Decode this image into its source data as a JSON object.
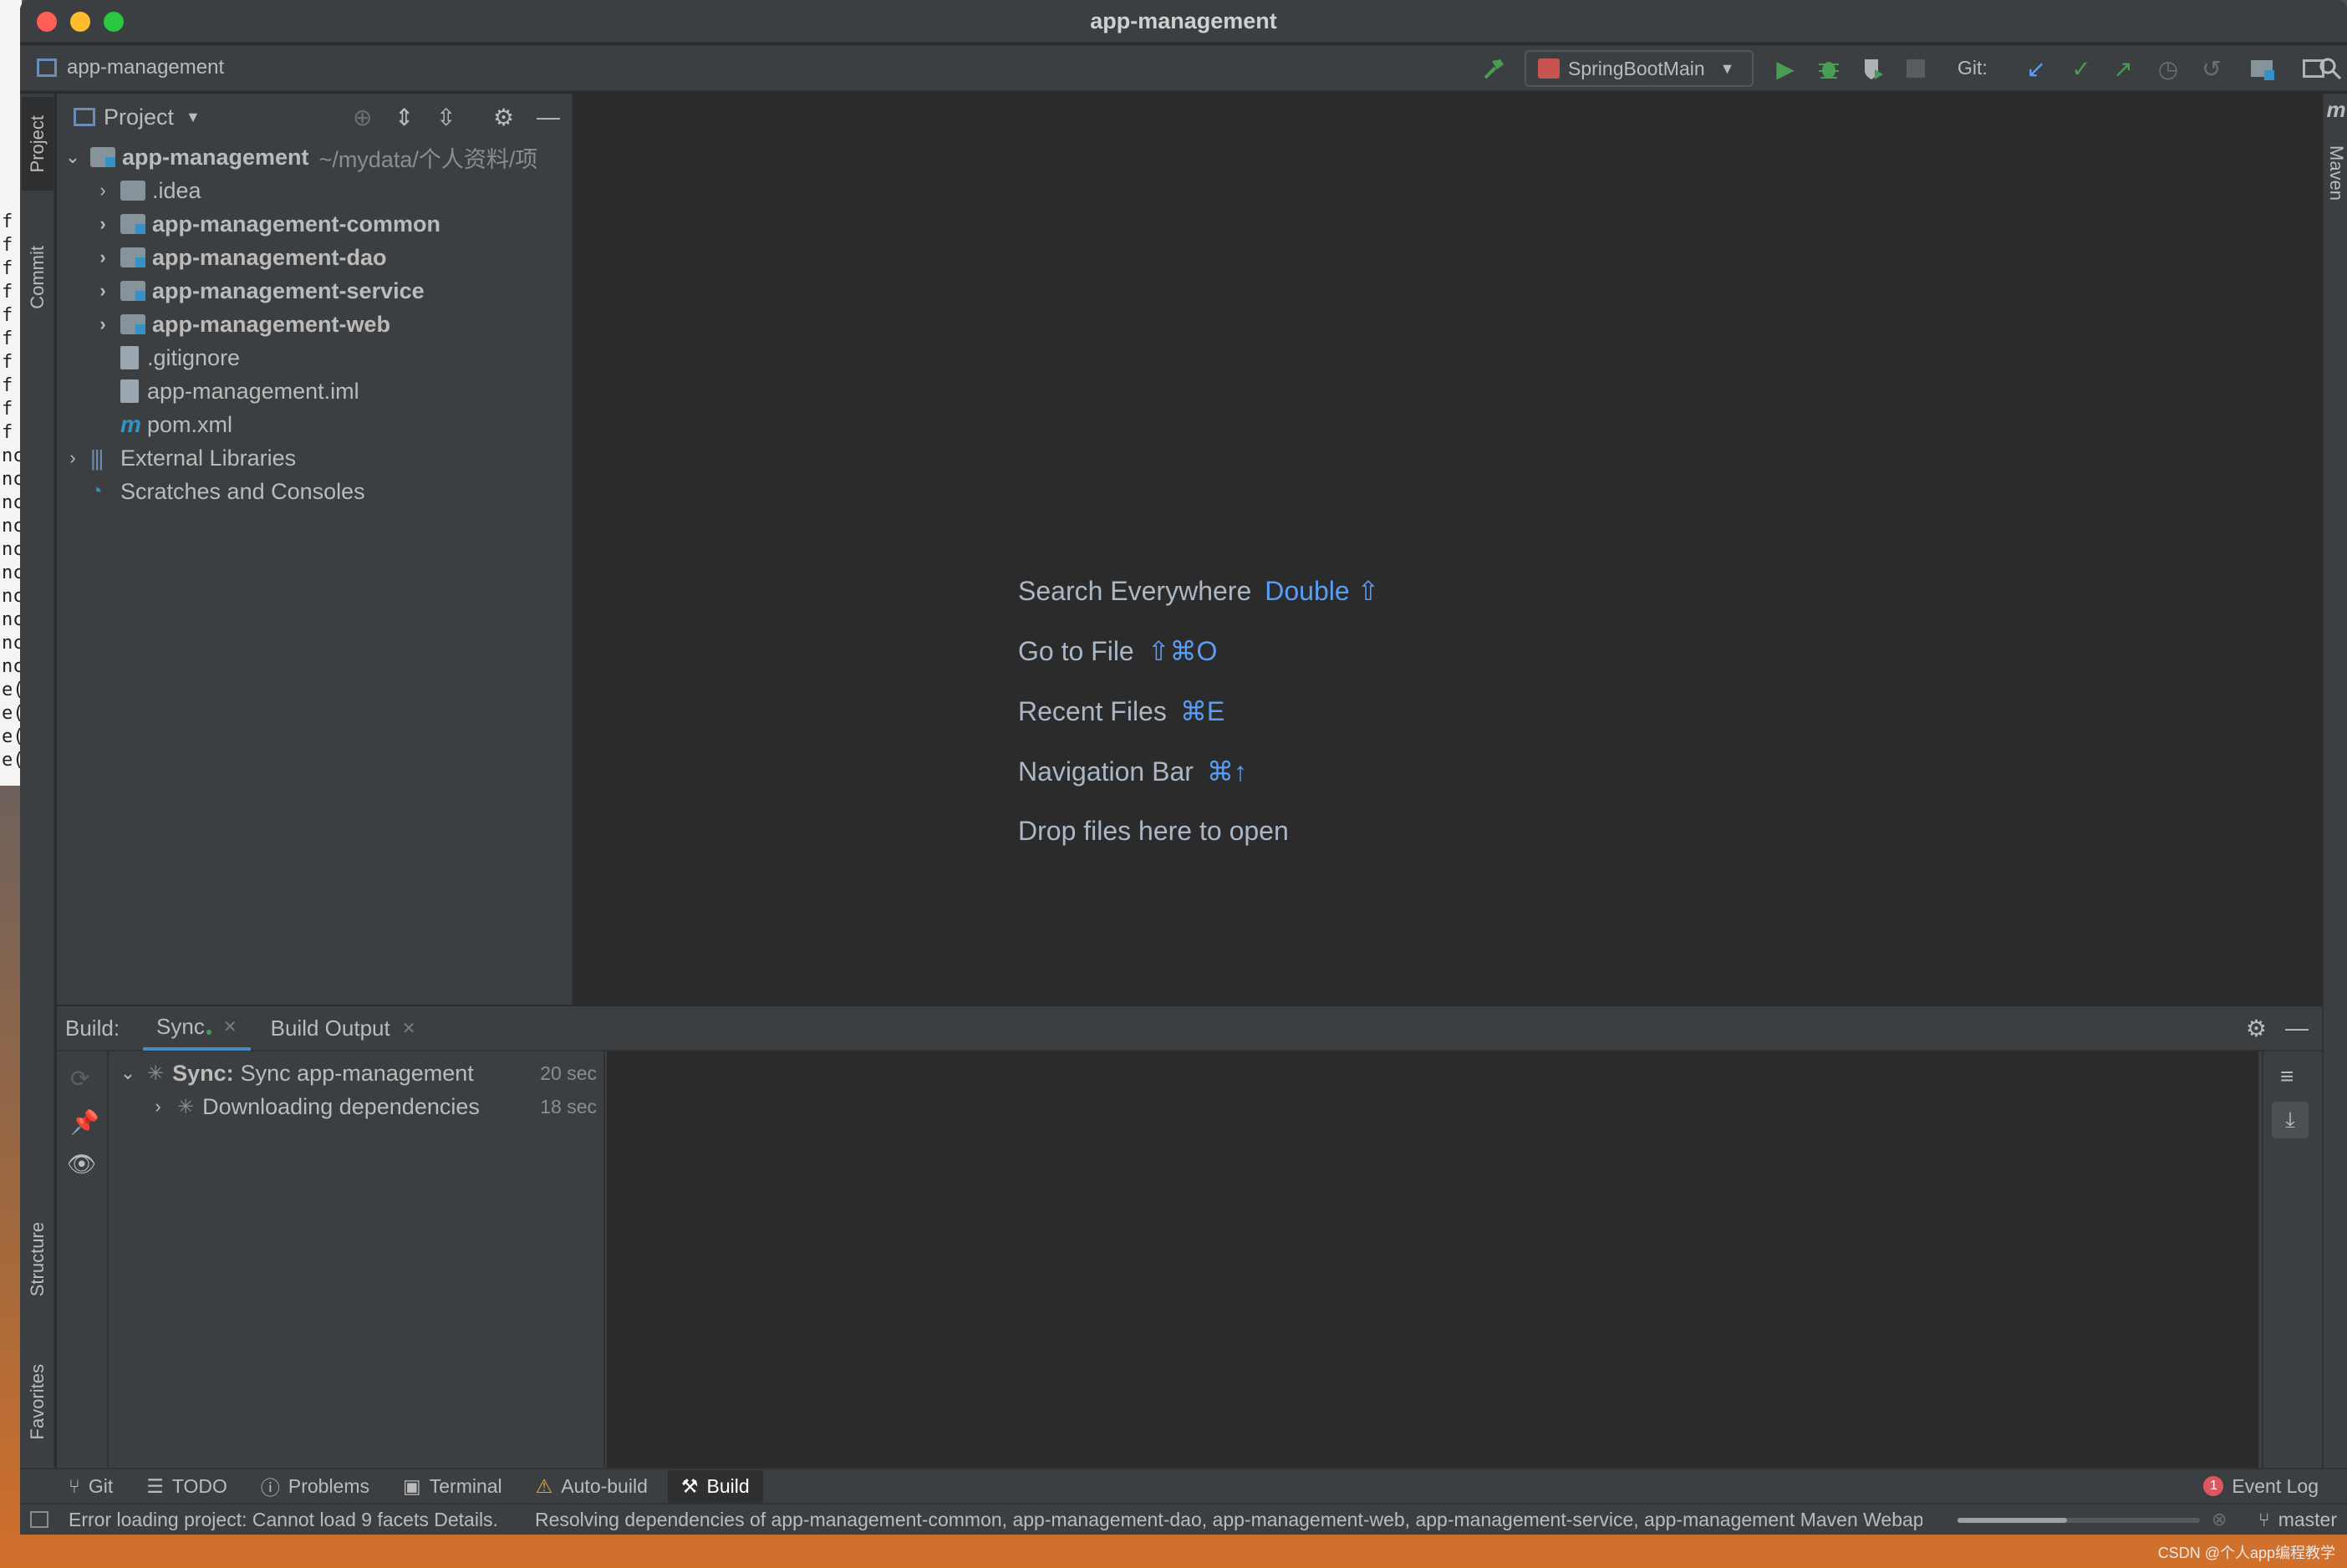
{
  "window": {
    "title": "app-management"
  },
  "background_lines": [
    "f",
    "f",
    "f",
    "f",
    "f",
    "f",
    "f",
    "f",
    "f",
    "f",
    "nc",
    "nc",
    "nc",
    "nc",
    "nc",
    "nc",
    "nc",
    "nc",
    "nc",
    "nc",
    "e(",
    "e(",
    "e(",
    "e("
  ],
  "toolbar": {
    "project_name": "app-management",
    "run_config": "SpringBootMain",
    "git_label": "Git:"
  },
  "left_tabs": {
    "project": "Project",
    "commit": "Commit",
    "structure": "Structure",
    "favorites": "Favorites"
  },
  "right_tabs": {
    "maven_icon": "m",
    "maven": "Maven"
  },
  "project_panel": {
    "title": "Project",
    "root": {
      "name": "app-management",
      "path": "~/mydata/个人资料/项"
    },
    "modules": [
      "app-management-common",
      "app-management-dao",
      "app-management-service",
      "app-management-web"
    ],
    "idea": ".idea",
    "files": [
      ".gitignore",
      "app-management.iml",
      "pom.xml"
    ],
    "external": "External Libraries",
    "scratches": "Scratches and Consoles"
  },
  "editor_hints": [
    {
      "label": "Search Everywhere",
      "key": "Double ⇧"
    },
    {
      "label": "Go to File",
      "key": "⇧⌘O"
    },
    {
      "label": "Recent Files",
      "key": "⌘E"
    },
    {
      "label": "Navigation Bar",
      "key": "⌘↑"
    },
    {
      "label": "Drop files here to open",
      "key": ""
    }
  ],
  "build": {
    "label": "Build:",
    "tabs": [
      "Sync",
      "Build Output"
    ],
    "sync_prefix": "Sync:",
    "sync_text": "Sync app-management",
    "sync_time": "20 sec",
    "download_text": "Downloading dependencies",
    "download_time": "18 sec"
  },
  "bottom_tabs": [
    "Git",
    "TODO",
    "Problems",
    "Terminal",
    "Auto-build",
    "Build"
  ],
  "event_log": {
    "count": "1",
    "label": "Event Log"
  },
  "status": {
    "error": "Error loading project: Cannot load 9 facets Details.",
    "resolving": "Resolving dependencies of app-management-common, app-management-dao, app-management-web, app-management-service, app-management Maven Webapp...",
    "progress": 0.45,
    "branch": "master"
  },
  "watermark": "CSDN @个人app编程教学",
  "colors": {
    "accent": "#589df6",
    "run_green": "#499c54",
    "error_red": "#db5860",
    "bg_dark": "#2b2b2b",
    "panel": "#3c3f41"
  }
}
